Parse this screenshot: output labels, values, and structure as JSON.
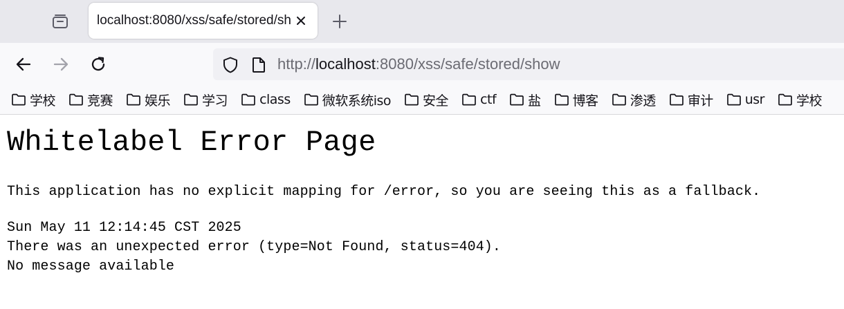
{
  "tab": {
    "title": "localhost:8080/xss/safe/stored/sh",
    "close_icon": "close-icon",
    "new_tab_icon": "plus-icon",
    "tab_manager_icon": "tab-manager-icon"
  },
  "nav": {
    "back_icon": "arrow-left-icon",
    "forward_icon": "arrow-right-icon",
    "reload_icon": "reload-icon"
  },
  "url": {
    "scheme": "http://",
    "host": "localhost",
    "rest": ":8080/xss/safe/stored/show"
  },
  "bookmarks": [
    {
      "label": "学校"
    },
    {
      "label": "竞赛"
    },
    {
      "label": "娱乐"
    },
    {
      "label": "学习"
    },
    {
      "label": "class"
    },
    {
      "label": "微软系统iso"
    },
    {
      "label": "安全"
    },
    {
      "label": "ctf"
    },
    {
      "label": "盐"
    },
    {
      "label": "博客"
    },
    {
      "label": "渗透"
    },
    {
      "label": "审计"
    },
    {
      "label": "usr"
    },
    {
      "label": "学校"
    }
  ],
  "page": {
    "title": "Whitelabel Error Page",
    "explanation": "This application has no explicit mapping for /error, so you are seeing this as a fallback.",
    "timestamp": "Sun May 11 12:14:45 CST 2025",
    "error": "There was an unexpected error (type=Not Found, status=404).",
    "message": "No message available"
  }
}
